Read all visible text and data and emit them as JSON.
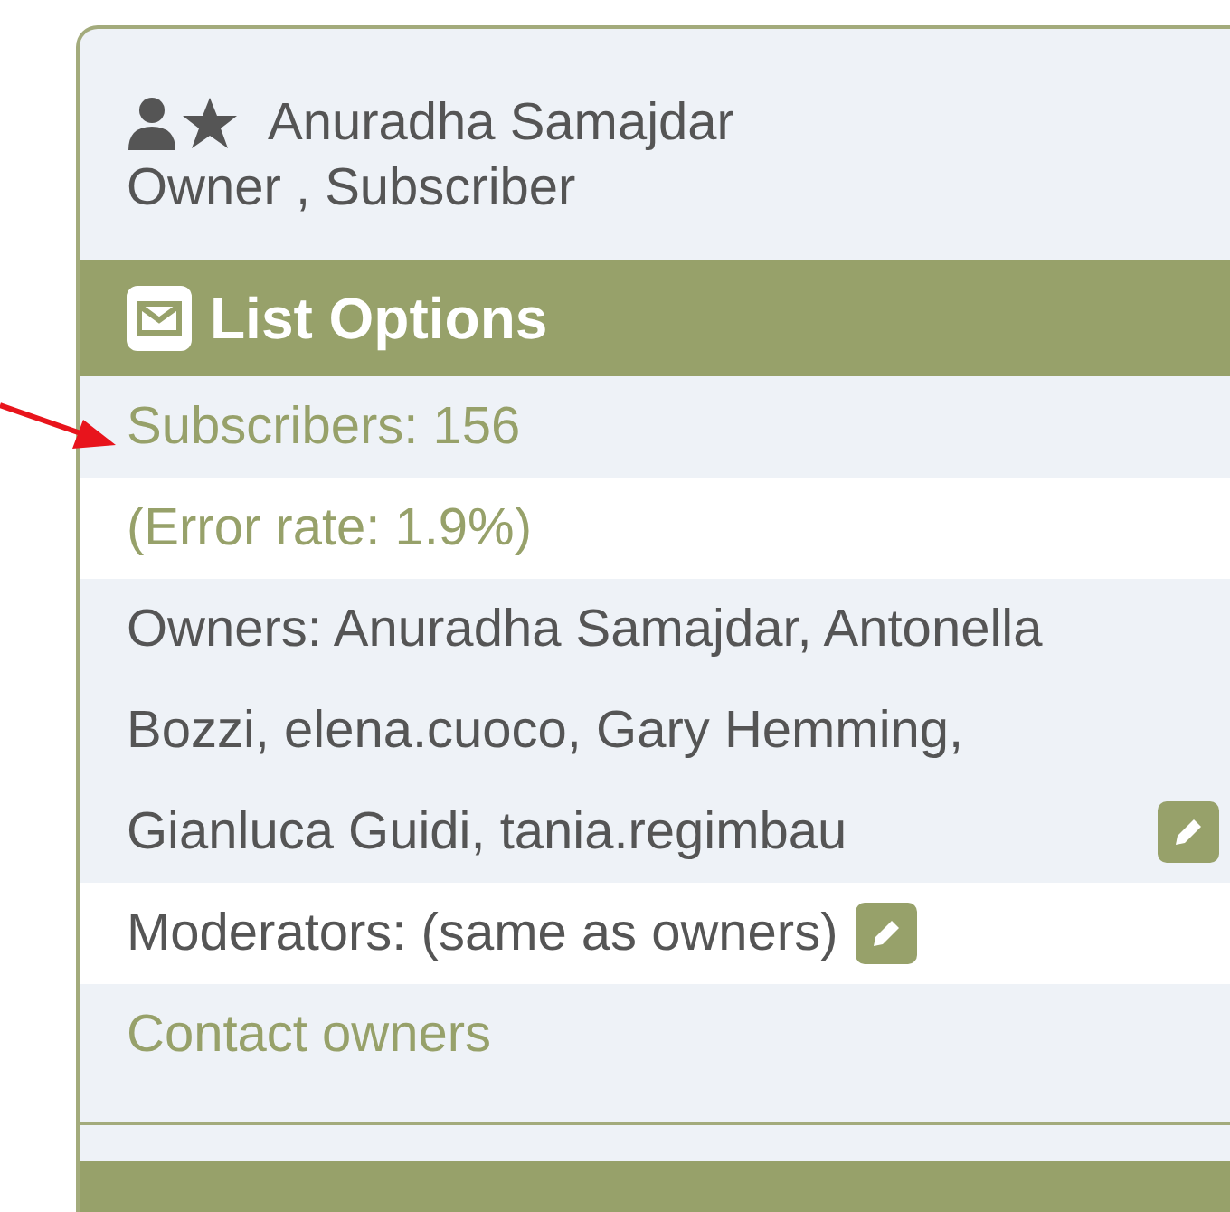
{
  "user": {
    "name": "Anuradha Samajdar",
    "roles": "Owner , Subscriber"
  },
  "section": {
    "title": "List Options"
  },
  "rows": [
    {
      "kind": "link",
      "text": "Subscribers: 156",
      "editable": false
    },
    {
      "kind": "link",
      "text": "(Error rate: 1.9%)",
      "editable": false
    },
    {
      "kind": "plain",
      "text": "Owners: Anuradha Samajdar, Antonella Bozzi, elena.cuoco, Gary Hemming, Gianluca Guidi, tania.regimbau",
      "editable": true
    },
    {
      "kind": "plain",
      "text": "Moderators: (same as owners)",
      "editable": true
    },
    {
      "kind": "link",
      "text": "Contact owners",
      "editable": false
    }
  ]
}
